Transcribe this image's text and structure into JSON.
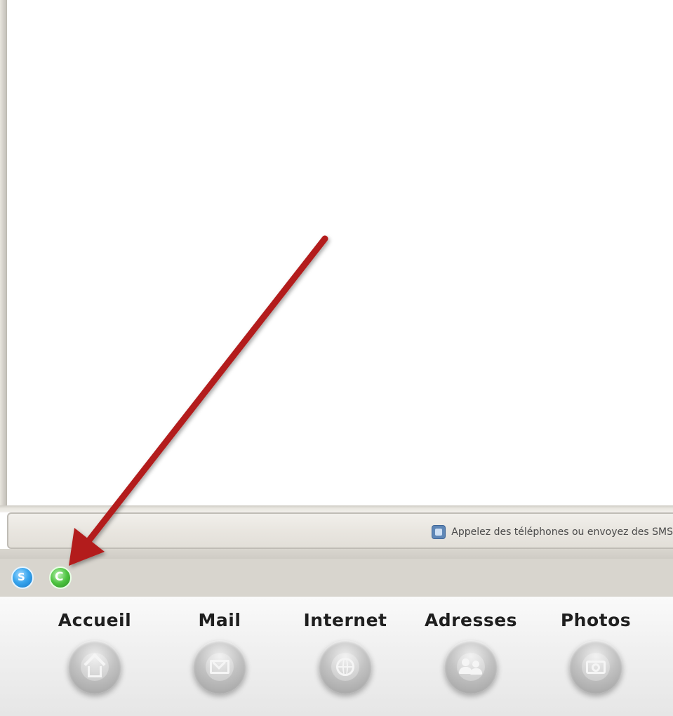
{
  "status_bar": {
    "message": "Appelez des téléphones ou envoyez des SMS",
    "icon": "phone-icon"
  },
  "tray": {
    "items": [
      {
        "icon": "skype-icon",
        "glyph": "S"
      },
      {
        "icon": "call-phone-icon",
        "glyph": "C"
      }
    ]
  },
  "dock": {
    "items": [
      {
        "label": "Accueil",
        "icon": "home-icon"
      },
      {
        "label": "Mail",
        "icon": "mail-icon"
      },
      {
        "label": "Internet",
        "icon": "globe-icon"
      },
      {
        "label": "Adresses",
        "icon": "contacts-icon"
      },
      {
        "label": "Photos",
        "icon": "camera-icon"
      }
    ]
  },
  "annotation": {
    "arrow_color": "#b31b1b",
    "points_to": "call-phone-icon"
  }
}
